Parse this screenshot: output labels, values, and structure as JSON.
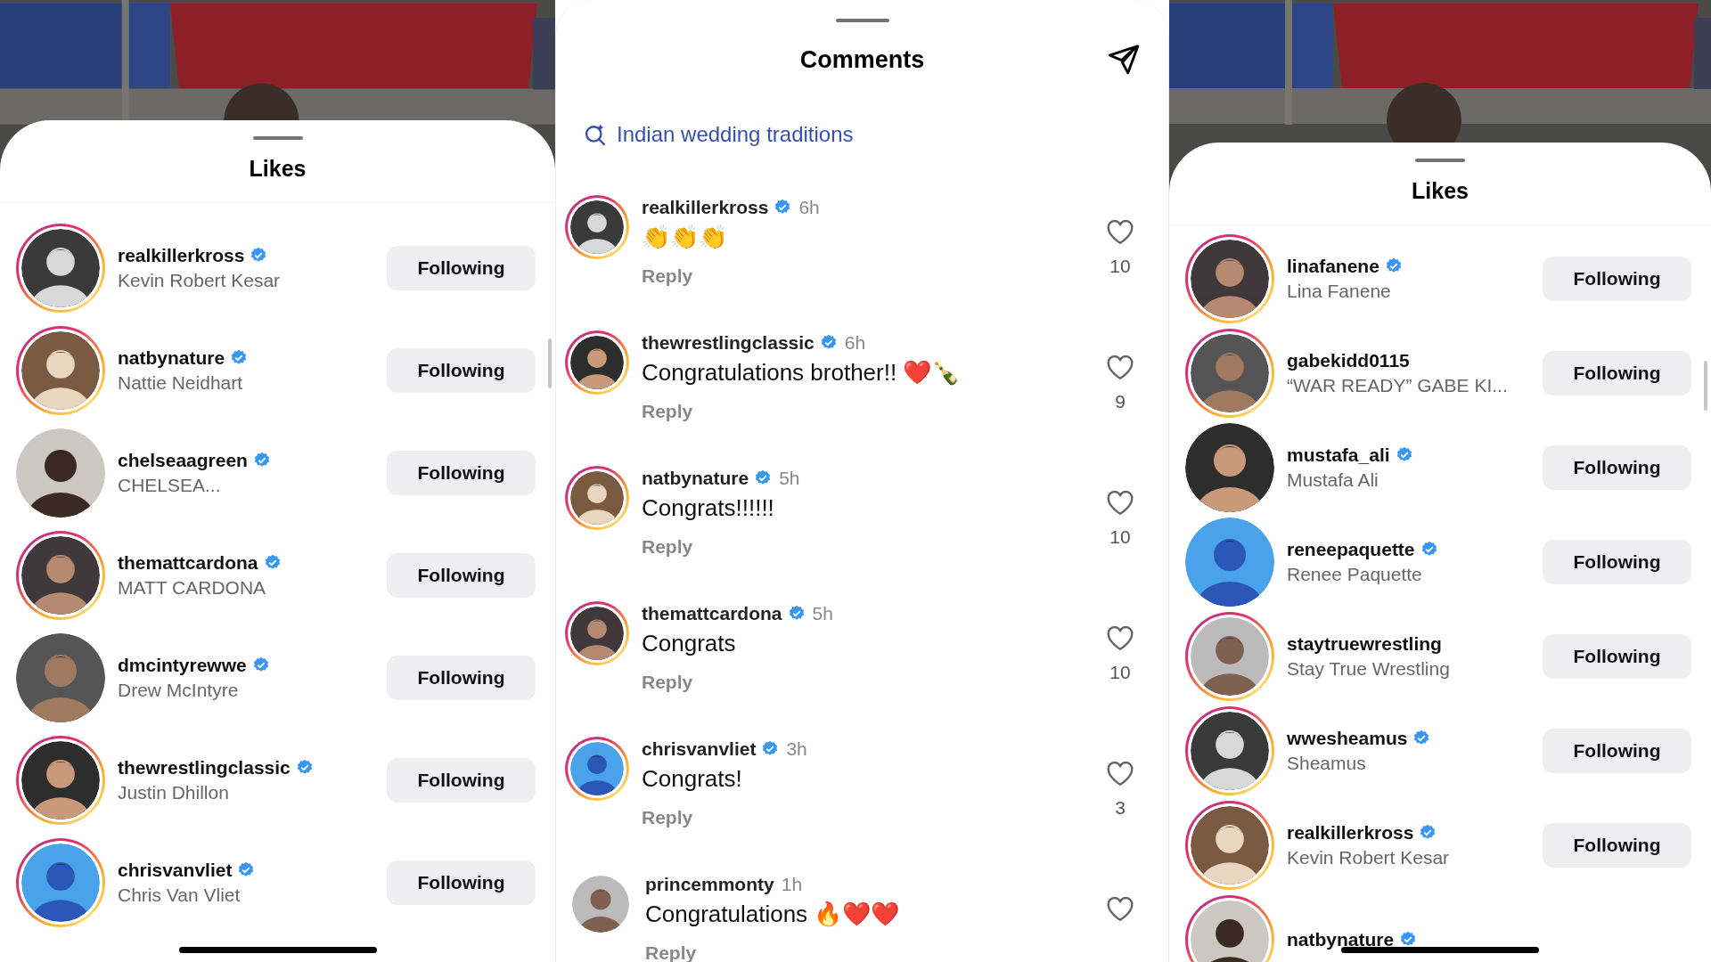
{
  "left_likes": {
    "title": "Likes",
    "users": [
      {
        "username": "realkillerkross",
        "verified": true,
        "name": "Kevin Robert Kesar",
        "story_ring": true,
        "button": "Following"
      },
      {
        "username": "natbynature",
        "verified": true,
        "name": "Nattie Neidhart",
        "story_ring": true,
        "button": "Following"
      },
      {
        "username": "chelseaagreen",
        "verified": true,
        "name": "CHELSEA...",
        "story_ring": false,
        "button": "Following"
      },
      {
        "username": "themattcardona",
        "verified": true,
        "name": "MATT CARDONA",
        "story_ring": true,
        "button": "Following"
      },
      {
        "username": "dmcintyrewwe",
        "verified": true,
        "name": "Drew McIntyre",
        "story_ring": false,
        "button": "Following"
      },
      {
        "username": "thewrestlingclassic",
        "verified": true,
        "name": "Justin Dhillon",
        "story_ring": true,
        "button": "Following"
      },
      {
        "username": "chrisvanvliet",
        "verified": true,
        "name": "Chris Van Vliet",
        "story_ring": true,
        "button": "Following"
      }
    ]
  },
  "comments": {
    "title": "Comments",
    "search_suggestion": "Indian wedding traditions",
    "items": [
      {
        "username": "realkillerkross",
        "verified": true,
        "time": "6h",
        "text": "👏👏👏",
        "reply": "Reply",
        "likes": "10",
        "story_ring": true
      },
      {
        "username": "thewrestlingclassic",
        "verified": true,
        "time": "6h",
        "text": "Congratulations brother!! ❤️🍾",
        "reply": "Reply",
        "likes": "9",
        "story_ring": true
      },
      {
        "username": "natbynature",
        "verified": true,
        "time": "5h",
        "text": "Congrats!!!!!!",
        "reply": "Reply",
        "likes": "10",
        "story_ring": true
      },
      {
        "username": "themattcardona",
        "verified": true,
        "time": "5h",
        "text": "Congrats",
        "reply": "Reply",
        "likes": "10",
        "story_ring": true
      },
      {
        "username": "chrisvanvliet",
        "verified": true,
        "time": "3h",
        "text": "Congrats!",
        "reply": "Reply",
        "likes": "3",
        "story_ring": true
      },
      {
        "username": "princemmonty",
        "verified": false,
        "time": "1h",
        "text": "Congratulations 🔥❤️❤️",
        "reply": "Reply",
        "story_ring": false
      }
    ]
  },
  "right_likes": {
    "title": "Likes",
    "users": [
      {
        "username": "linafanene",
        "verified": true,
        "name": "Lina Fanene",
        "story_ring": true,
        "button": "Following"
      },
      {
        "username": "gabekidd0115",
        "verified": false,
        "name": "“WAR READY” GABE KI...",
        "story_ring": true,
        "button": "Following"
      },
      {
        "username": "mustafa_ali",
        "verified": true,
        "name": "Mustafa Ali",
        "story_ring": false,
        "button": "Following"
      },
      {
        "username": "reneepaquette",
        "verified": true,
        "name": "Renee Paquette",
        "story_ring": false,
        "button": "Following"
      },
      {
        "username": "staytruewrestling",
        "verified": false,
        "name": "Stay True Wrestling",
        "story_ring": true,
        "button": "Following"
      },
      {
        "username": "wwesheamus",
        "verified": true,
        "name": "Sheamus",
        "story_ring": true,
        "button": "Following"
      },
      {
        "username": "realkillerkross",
        "verified": true,
        "name": "Kevin Robert Kesar",
        "story_ring": true,
        "button": "Following"
      },
      {
        "username": "natbynature",
        "verified": true,
        "story_ring": true
      }
    ]
  }
}
